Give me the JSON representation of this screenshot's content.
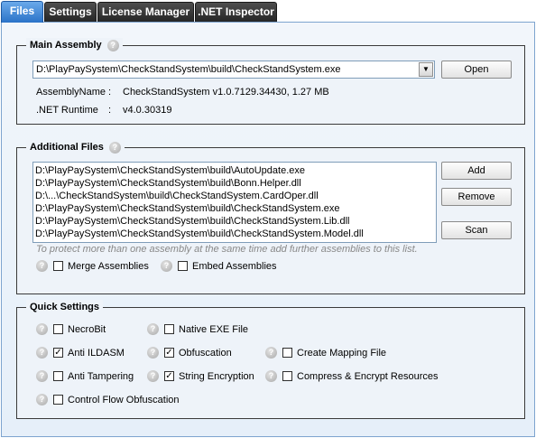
{
  "tabs": [
    {
      "label": "Files"
    },
    {
      "label": "Settings"
    },
    {
      "label": "License Manager"
    },
    {
      "label": ".NET Inspector"
    }
  ],
  "help_glyph": "?",
  "main_assembly": {
    "title": "Main Assembly",
    "path": "D:\\PlayPaySystem\\CheckStandSystem\\build\\CheckStandSystem.exe",
    "dropdown_glyph": "▼",
    "open_label": "Open",
    "assembly_name_key": "AssemblyName",
    "assembly_name_sep": ":",
    "assembly_name_value": "CheckStandSystem  v1.0.7129.34430,  1.27 MB",
    "runtime_key": ".NET Runtime",
    "runtime_sep": ":",
    "runtime_value": "v4.0.30319"
  },
  "additional_files": {
    "title": "Additional Files",
    "files": [
      "D:\\PlayPaySystem\\CheckStandSystem\\build\\AutoUpdate.exe",
      "D:\\PlayPaySystem\\CheckStandSystem\\build\\Bonn.Helper.dll",
      "D:\\...\\CheckStandSystem\\build\\CheckStandSystem.CardOper.dll",
      "D:\\PlayPaySystem\\CheckStandSystem\\build\\CheckStandSystem.exe",
      "D:\\PlayPaySystem\\CheckStandSystem\\build\\CheckStandSystem.Lib.dll",
      "D:\\PlayPaySystem\\CheckStandSystem\\build\\CheckStandSystem.Model.dll"
    ],
    "add_label": "Add",
    "remove_label": "Remove",
    "scan_label": "Scan",
    "hint": "To protect more than one assembly at the same time add further assemblies to this list.",
    "merge_label": "Merge Assemblies",
    "merge_checked": false,
    "embed_label": "Embed Assemblies",
    "embed_checked": false
  },
  "quick_settings": {
    "title": "Quick Settings",
    "check_glyph": "✓",
    "necrobit": {
      "label": "NecroBit",
      "checked": false
    },
    "native_exe": {
      "label": "Native EXE File",
      "checked": false
    },
    "anti_ildasm": {
      "label": "Anti ILDASM",
      "checked": true
    },
    "obfuscation": {
      "label": "Obfuscation",
      "checked": true
    },
    "create_mapping": {
      "label": "Create Mapping File",
      "checked": false
    },
    "anti_tampering": {
      "label": "Anti Tampering",
      "checked": false
    },
    "string_encryption": {
      "label": "String Encryption",
      "checked": true
    },
    "compress_encrypt": {
      "label": "Compress & Encrypt Resources",
      "checked": false
    },
    "control_flow": {
      "label": "Control Flow Obfuscation",
      "checked": false
    }
  }
}
